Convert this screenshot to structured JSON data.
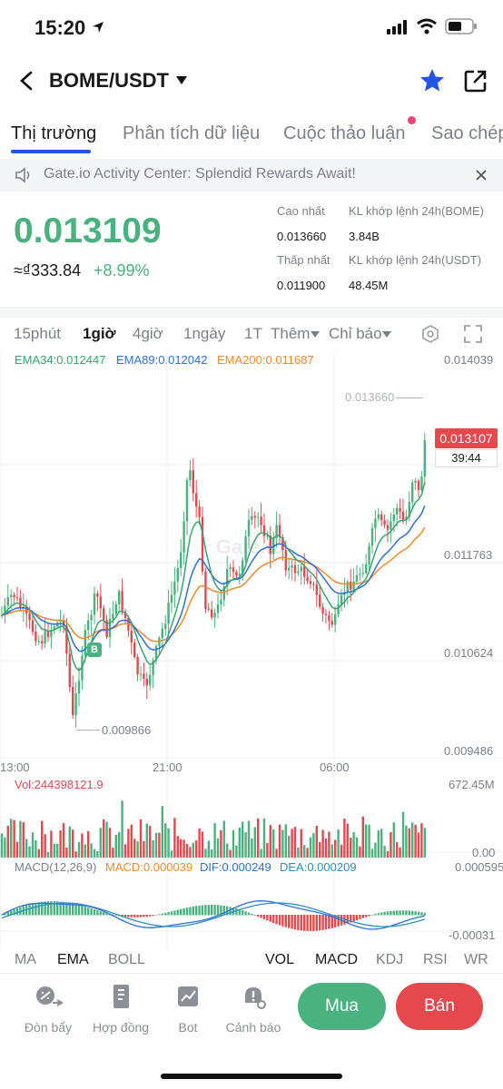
{
  "status_bar": {
    "time": "15:20"
  },
  "header": {
    "pair": "BOME/USDT"
  },
  "tabs": [
    {
      "label": "Thị trường"
    },
    {
      "label": "Phân tích dữ liệu"
    },
    {
      "label": "Cuộc thảo luận"
    },
    {
      "label": "Sao chép"
    }
  ],
  "notice": {
    "text": "Gate.io Activity Center: Splendid Rewards Await!"
  },
  "price": {
    "last": "0.013109",
    "fiat": "≈₫333.84",
    "change": "+8.99%"
  },
  "stats": {
    "high_label": "Cao nhất",
    "high": "0.013660",
    "low_label": "Thấp nhất",
    "low": "0.011900",
    "vol_base_label": "KL khớp lệnh 24h(BOME)",
    "vol_base": "3.84B",
    "vol_quote_label": "KL khớp lệnh 24h(USDT)",
    "vol_quote": "48.45M"
  },
  "intervals": {
    "items": [
      "15phút",
      "1giờ",
      "4giờ",
      "1ngày",
      "1T"
    ],
    "more": "Thêm",
    "indicators": "Chỉ báo",
    "active": "1giờ"
  },
  "ema_legend": {
    "ema34": "EMA34:0.012447",
    "ema89": "EMA89:0.012042",
    "ema200": "EMA200:0.011687"
  },
  "colors": {
    "up": "#4ab27e",
    "down": "#e5484d",
    "ema34": "#3aa46e",
    "ema89": "#2f6fd6",
    "ema200": "#f0892b",
    "accent": "#2354e6"
  },
  "chart_axis": {
    "price_ticks": [
      "0.014039",
      "0.011763",
      "0.010624",
      "0.009486"
    ],
    "high_marker": "0.013660",
    "low_marker": "0.009866",
    "time_ticks": [
      "13:00",
      "21:00",
      "06:00"
    ],
    "current_price": "0.013107",
    "countdown": "39:44",
    "buy_marker": "B"
  },
  "volume": {
    "label": "Vol:244398121.9",
    "max": "672.45M",
    "min": "0.00"
  },
  "macd": {
    "params": "MACD(12,26,9)",
    "macd": "MACD:0.000039",
    "dif": "DIF:0.000249",
    "dea": "DEA:0.000209",
    "max": "0.000595",
    "min": "-0.00031"
  },
  "indicator_tabs": {
    "main": [
      "MA",
      "EMA",
      "BOLL"
    ],
    "sub": [
      "VOL",
      "MACD",
      "KDJ",
      "RSI",
      "WR"
    ]
  },
  "bottom_nav": {
    "items": [
      {
        "label": "Đòn bẩy",
        "icon": "leverage-icon"
      },
      {
        "label": "Hợp đồng",
        "icon": "contract-icon"
      },
      {
        "label": "Bot",
        "icon": "bot-icon"
      },
      {
        "label": "Cảnh báo",
        "icon": "alert-icon"
      }
    ],
    "buy": "Mua",
    "sell": "Bán"
  }
}
